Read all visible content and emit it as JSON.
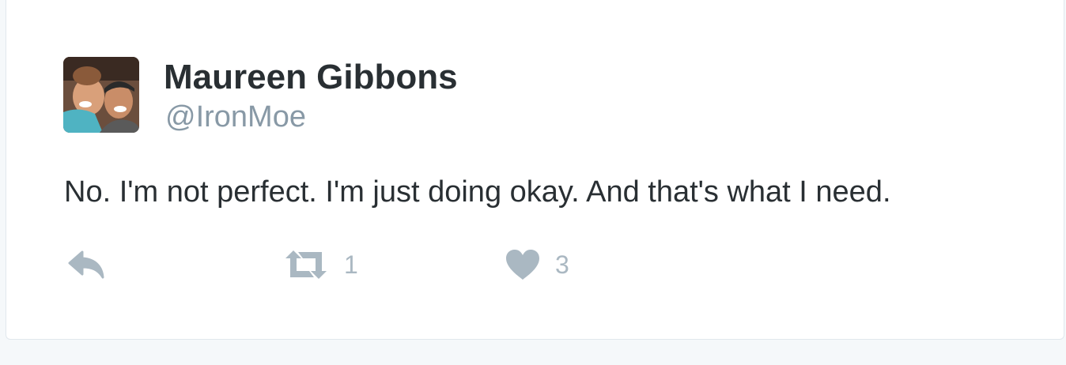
{
  "tweet": {
    "author_name": "Maureen Gibbons",
    "author_handle": "@IronMoe",
    "text": "No. I'm not perfect. I'm just doing okay. And that's what I need.",
    "avatar_icon": "profile-photo",
    "actions": {
      "reply": {
        "icon": "reply-icon"
      },
      "retweet": {
        "icon": "retweet-icon",
        "count": "1"
      },
      "like": {
        "icon": "heart-icon",
        "count": "3"
      }
    }
  },
  "colors": {
    "text": "#292f33",
    "muted": "#8899a6",
    "icon": "#aab8c2",
    "border": "#e1e8ed",
    "background": "#f5f8fa"
  }
}
